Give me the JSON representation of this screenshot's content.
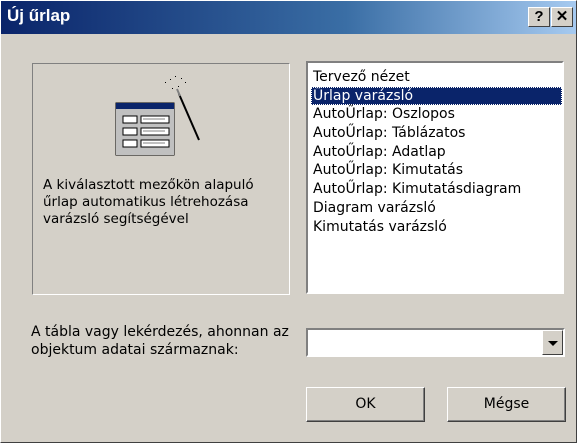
{
  "window": {
    "title": "Új űrlap",
    "help_label": "?",
    "close_label": "✕"
  },
  "preview": {
    "icon": "form-wizard-icon",
    "description": "A kiválasztott mezőkön alapuló űrlap automatikus létrehozása varázsló segítségével"
  },
  "options": {
    "items": [
      "Tervező nézet",
      "Űrlap varázsló",
      "AutoŰrlap: Oszlopos",
      "AutoŰrlap: Táblázatos",
      "AutoŰrlap: Adatlap",
      "AutoŰrlap:  Kimutatás",
      "AutoŰrlap:  Kimutatásdiagram",
      "Diagram varázsló",
      "Kimutatás varázsló"
    ],
    "selected": "Űrlap varázsló"
  },
  "source": {
    "label": "A tábla vagy lekérdezés, ahonnan az objektum adatai származnak:",
    "value": ""
  },
  "buttons": {
    "ok": "OK",
    "cancel": "Mégse"
  },
  "colors": {
    "selection": "#0a246a",
    "face": "#d4d0c8"
  }
}
